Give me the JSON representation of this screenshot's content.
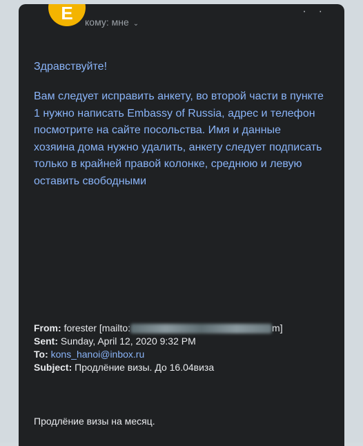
{
  "email": {
    "avatar_letter": "E",
    "recipient_label": "кому: мне",
    "greeting": "Здравствуйте!",
    "body": "Вам следует исправить анкету, во второй части в пункте 1 нужно написать Embassy of Russia, адрес и телефон посмотрите на сайте посольства. Имя и данные хозяина дома нужно удалить, анкету следует подписать только в крайней правой колонке, среднюю и левую оставить свободными",
    "from_label": "From:",
    "from_value": "forester [mailto:",
    "from_close": "m]",
    "sent_label": "Sent:",
    "sent_value": "Sunday, April 12, 2020 9:32 PM",
    "to_label": "To:",
    "to_value": "kons_hanoi@inbox.ru",
    "subject_label": "Subject:",
    "subject_value": "Продлёние визы. До 16.04виза",
    "footer_text": "Продлёние визы на месяц."
  }
}
